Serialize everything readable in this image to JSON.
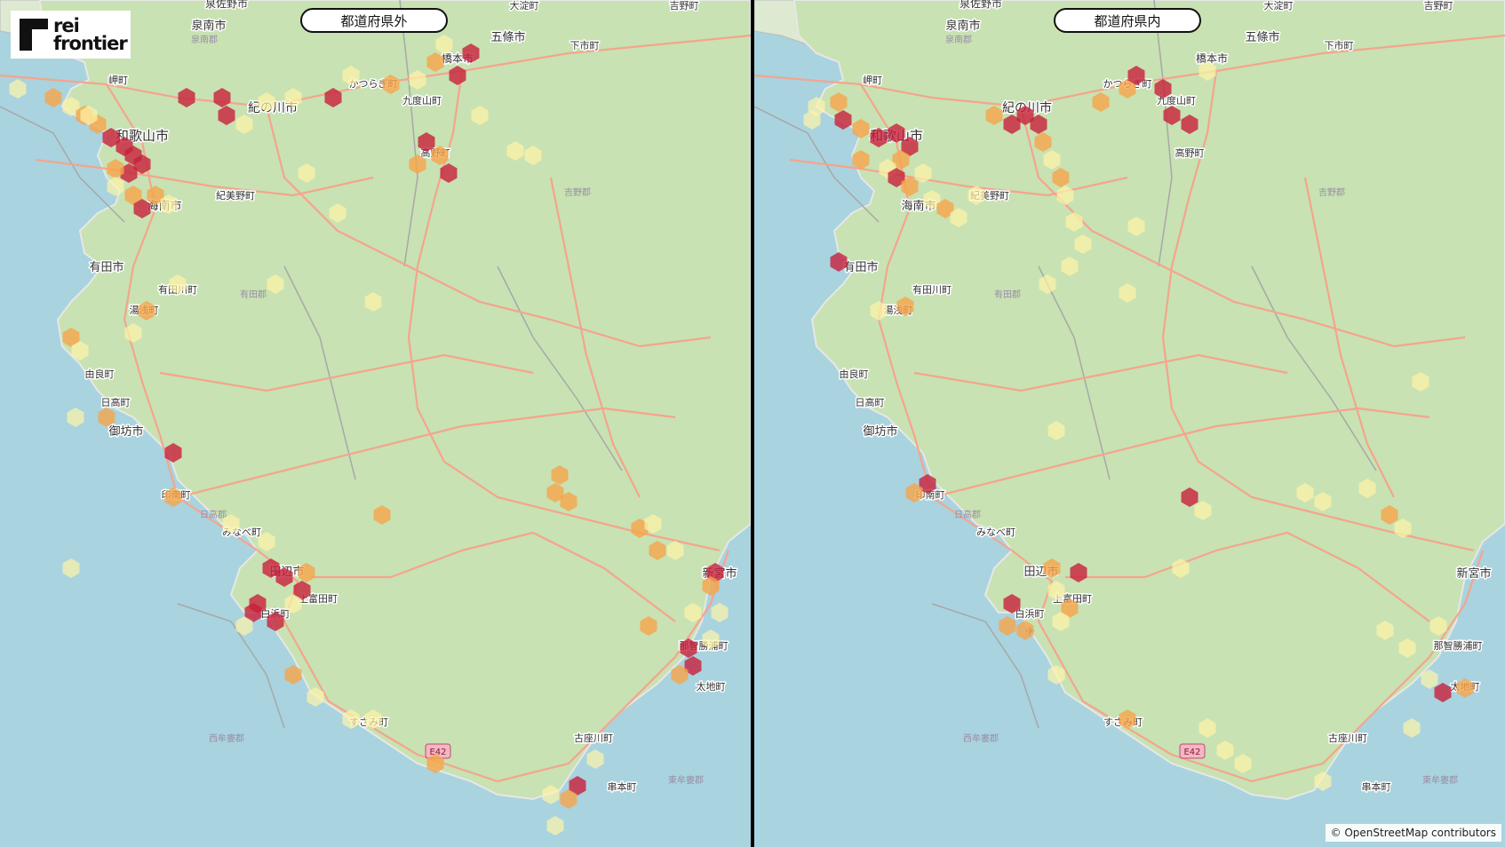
{
  "branding": {
    "logo_line1": "rei",
    "logo_line2": "frontier"
  },
  "attribution": "© OpenStreetMap contributors",
  "colors": {
    "sea": "#a9d3df",
    "land": "#c8e2b3",
    "road": "#f4a58c",
    "heat_low": "#fff3a8",
    "heat_mid": "#f6a54a",
    "heat_high": "#c8203b"
  },
  "panels": [
    {
      "title": "都道府県外"
    },
    {
      "title": "都道府県内"
    }
  ],
  "places": {
    "towns": [
      "泉佐野市",
      "泉南市",
      "岬町",
      "和歌山市",
      "紀の川市",
      "かつらぎ町",
      "橋本市",
      "五條市",
      "九度山町",
      "高野町",
      "海南市",
      "紀美野町",
      "有田市",
      "有田川町",
      "湯浅町",
      "由良町",
      "日高町",
      "御坊市",
      "印南町",
      "みなべ町",
      "田辺市",
      "上富田町",
      "白浜町",
      "すさみ町",
      "古座川町",
      "串本町",
      "那智勝浦町",
      "太地町",
      "新宮市",
      "大淀町",
      "下市町",
      "吉野町"
    ],
    "districts": [
      "泉南郡",
      "吉野郡",
      "有田郡",
      "日高郡",
      "西牟婁郡",
      "東牟婁郡"
    ],
    "road_shield": "E42"
  }
}
